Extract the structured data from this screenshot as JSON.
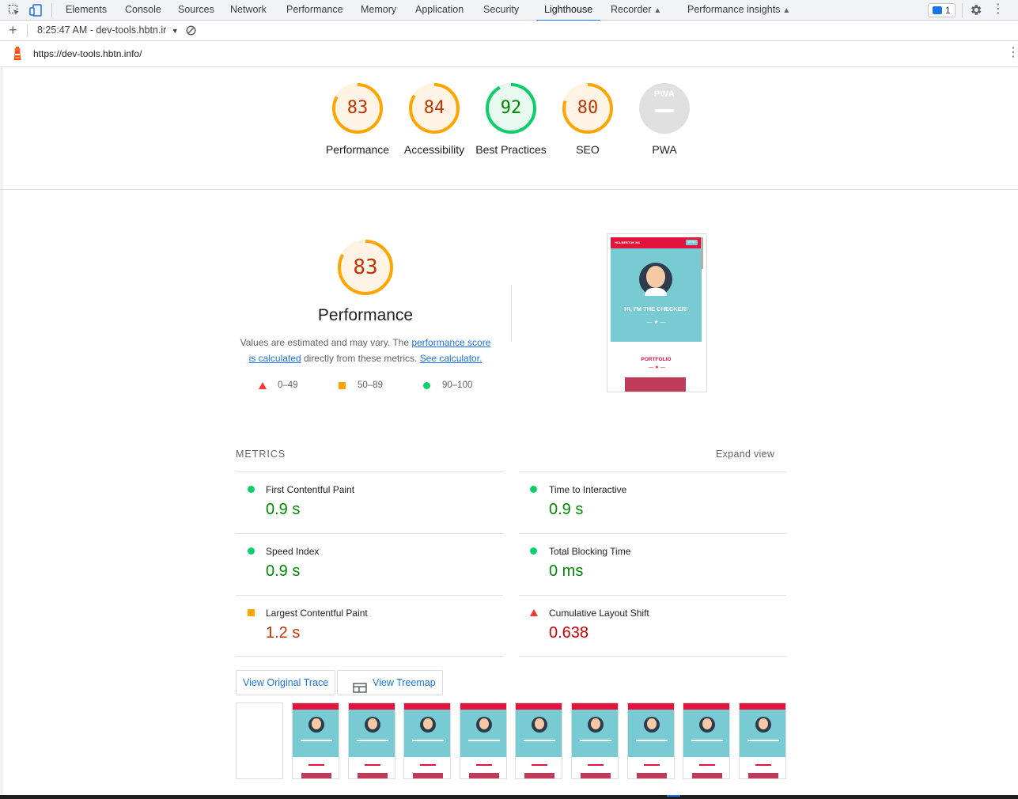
{
  "devtools": {
    "tabs": [
      "Elements",
      "Console",
      "Sources",
      "Network",
      "Performance",
      "Memory",
      "Application",
      "Security",
      "Lighthouse",
      "Recorder",
      "Performance insights"
    ],
    "active_tab": "Lighthouse",
    "issues_count": "1",
    "report_selector": "8:25:47 AM - dev-tools.hbtn.ir",
    "url": "https://dev-tools.hbtn.info/"
  },
  "categories": [
    {
      "label": "Performance",
      "score": "83",
      "color": "#ffa400"
    },
    {
      "label": "Accessibility",
      "score": "84",
      "color": "#ffa400"
    },
    {
      "label": "Best Practices",
      "score": "92",
      "color": "#0cce6b"
    },
    {
      "label": "SEO",
      "score": "80",
      "color": "#ffa400"
    },
    {
      "label": "PWA",
      "score": "",
      "color": "#9e9e9e"
    }
  ],
  "pwa_badge": "PWA",
  "performance": {
    "score": "83",
    "title": "Performance",
    "desc_prefix": "Values are estimated and may vary. The ",
    "desc_link1": "performance score is calculated",
    "desc_mid": " directly from these metrics. ",
    "desc_link2": "See calculator.",
    "legend": [
      {
        "shape": "triangle",
        "range": "0–49",
        "color": "#ff3333"
      },
      {
        "shape": "square",
        "range": "50–89",
        "color": "#ffa400"
      },
      {
        "shape": "circle",
        "range": "90–100",
        "color": "#0cce6b"
      }
    ]
  },
  "screenshot": {
    "site_name": "HOLBERTON HS",
    "menu_label": "MENU",
    "hero_text": "HI, I'M THE CHECKER!",
    "section_text": "PORTFOLIO"
  },
  "metrics": {
    "heading": "METRICS",
    "expand_label": "Expand view",
    "items": [
      {
        "name": "First Contentful Paint",
        "value": "0.9 s",
        "status": "good"
      },
      {
        "name": "Time to Interactive",
        "value": "0.9 s",
        "status": "good"
      },
      {
        "name": "Speed Index",
        "value": "0.9 s",
        "status": "good"
      },
      {
        "name": "Total Blocking Time",
        "value": "0 ms",
        "status": "good"
      },
      {
        "name": "Largest Contentful Paint",
        "value": "1.2 s",
        "status": "average"
      },
      {
        "name": "Cumulative Layout Shift",
        "value": "0.638",
        "status": "fail"
      }
    ]
  },
  "buttons": {
    "view_trace": "View Original Trace",
    "view_treemap": "View Treemap"
  },
  "colors": {
    "good": "#0cce6b",
    "average": "#ffa400",
    "fail": "#ff3333",
    "link": "#1a73e8"
  }
}
